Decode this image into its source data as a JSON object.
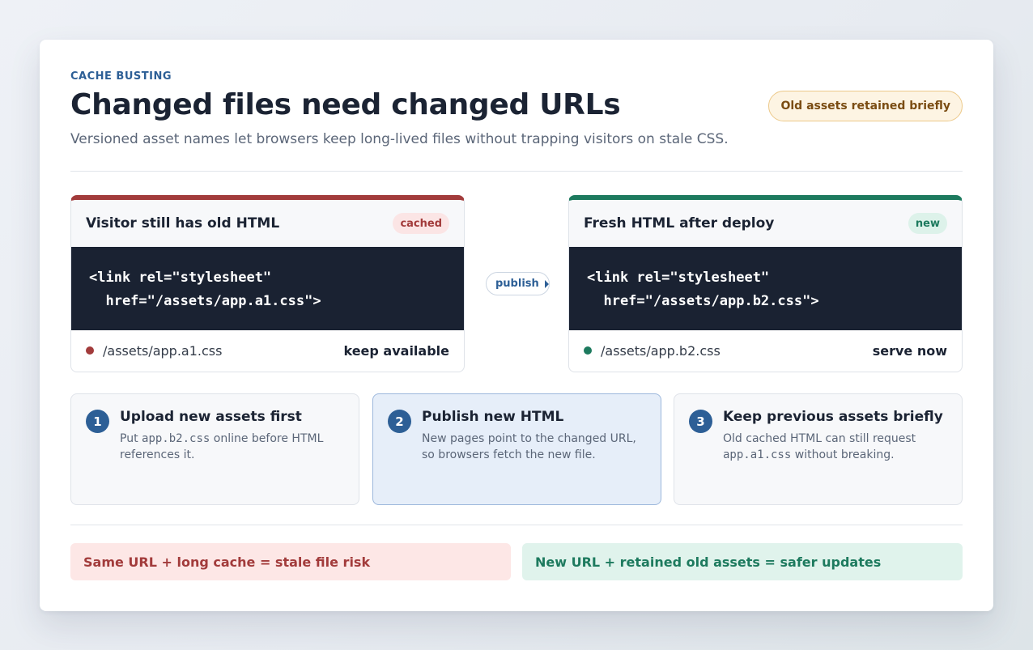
{
  "header": {
    "eyebrow": "CACHE BUSTING",
    "title": "Changed files need changed URLs",
    "subtitle": "Versioned asset names let browsers keep long-lived files without trapping visitors on stale CSS.",
    "badge": "Old assets retained briefly"
  },
  "panels": {
    "old": {
      "title": "Visitor still has old HTML",
      "tag": "cached",
      "code_line1": "<link rel=\"stylesheet\"",
      "code_line2": "  href=\"/assets/app.a1.css\">",
      "file": "/assets/app.a1.css",
      "action": "keep available",
      "accent": "#a23b3b"
    },
    "new": {
      "title": "Fresh HTML after deploy",
      "tag": "new",
      "code_line1": "<link rel=\"stylesheet\"",
      "code_line2": "  href=\"/assets/app.b2.css\">",
      "file": "/assets/app.b2.css",
      "action": "serve now",
      "accent": "#1d7a5e"
    }
  },
  "connector": {
    "label": "publish"
  },
  "steps": [
    {
      "number": "1",
      "title": "Upload new assets first",
      "desc_a": "Put ",
      "desc_code": "app.b2.css",
      "desc_b": " online before HTML references it."
    },
    {
      "number": "2",
      "title": "Publish new HTML",
      "desc": "New pages point to the changed URL, so browsers fetch the new file."
    },
    {
      "number": "3",
      "title": "Keep previous assets briefly",
      "desc_a": "Old cached HTML can still request ",
      "desc_code": "app.a1.css",
      "desc_b": " without breaking."
    }
  ],
  "callouts": {
    "bad": "Same URL + long cache = stale file risk",
    "good": "New URL + retained old assets = safer updates"
  }
}
